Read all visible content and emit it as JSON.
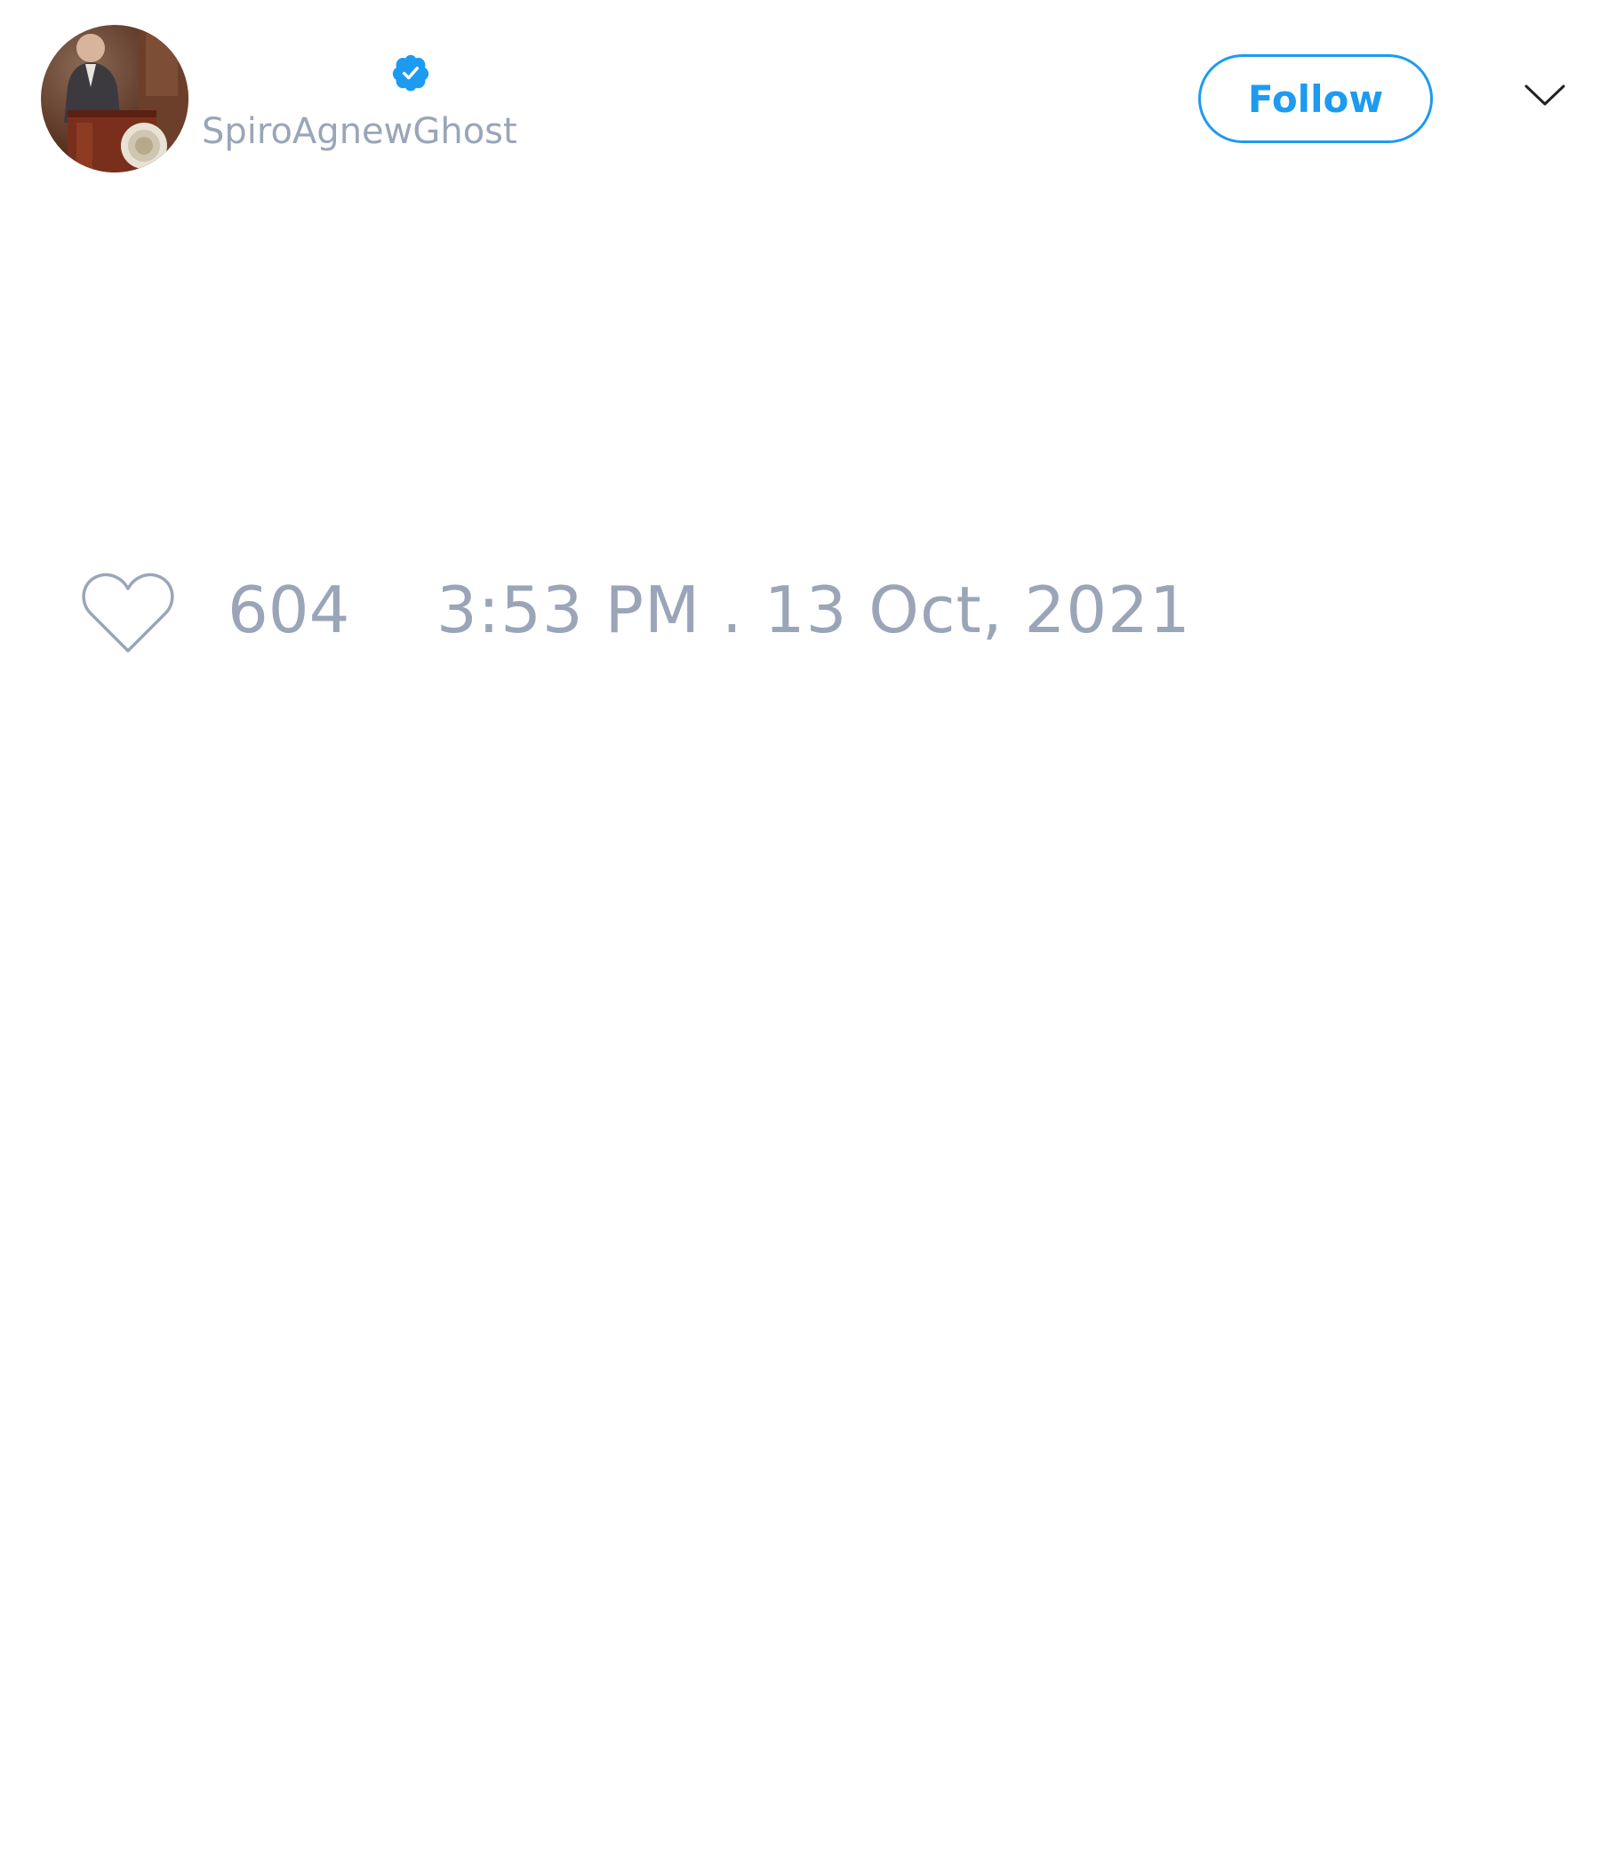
{
  "tweet": {
    "author": {
      "handle": "SpiroAgnewGhost",
      "verified": true,
      "avatar": "avatar-photo"
    },
    "follow_label": "Follow",
    "menu_icon": "chevron-down-icon",
    "like_icon": "heart-icon",
    "like_count": "604",
    "timestamp": "3:53 PM . 13 Oct, 2021"
  },
  "colors": {
    "accent": "#1d9bf0",
    "muted_text": "#9aa5b8",
    "background": "#ffffff"
  }
}
